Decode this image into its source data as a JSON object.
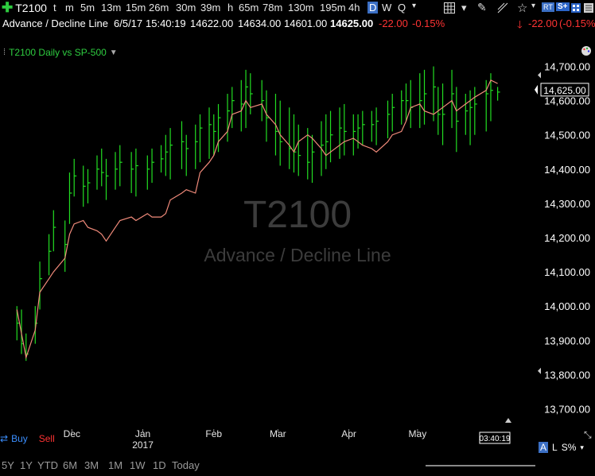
{
  "toolbar": {
    "symbol": "T2100",
    "timeframes": [
      "t",
      "m",
      "5m",
      "13m",
      "15m",
      "26m",
      "30m",
      "39m",
      "h",
      "65m",
      "78m",
      "130m",
      "195m",
      "4h",
      "D",
      "W",
      "Q"
    ],
    "active_timeframe": "D",
    "rt_badge": "RT",
    "s_badge": "S+"
  },
  "info": {
    "name": "Advance / Decline Line",
    "date": "6/5/17",
    "time": "15:40:19",
    "open": "14622.00",
    "high": "14634.00",
    "low": "14601.00",
    "close": "14625.00",
    "change": "-22.00",
    "change_pct": "-0.15%",
    "right_change": "-22.00",
    "right_change_pct": "(-0.15%)"
  },
  "study": {
    "label": "T2100 Daily vs SP-500"
  },
  "watermark": {
    "symbol": "T2100",
    "name": "Advance / Decline Line"
  },
  "price_axis": {
    "labels": [
      "14,700.00",
      "14,600.00",
      "14,500.00",
      "14,400.00",
      "14,300.00",
      "14,200.00",
      "14,100.00",
      "14,000.00",
      "13,900.00",
      "13,800.00",
      "13,700.00"
    ],
    "current_price_label": "14,625.00"
  },
  "x_axis": {
    "labels": [
      "Dec",
      "Jan",
      "Feb",
      "Mar",
      "Apr",
      "May"
    ],
    "year_label": "2017",
    "time_box": "03:40:19"
  },
  "trade": {
    "buy": "Buy",
    "sell": "Sell"
  },
  "bottom": {
    "ranges": [
      "5Y",
      "1Y",
      "YTD",
      "6M",
      "3M",
      "1M",
      "1W",
      "1D",
      "Today"
    ],
    "right_a": "A",
    "right_l": "L",
    "right_s": "S%"
  },
  "colors": {
    "bar": "#22dd22",
    "line": "#f08a7a",
    "up": "#22dd22",
    "down": "#ff3333",
    "accent": "#3b6fc4"
  },
  "chart_data": {
    "type": "line",
    "ylim": [
      13650,
      14750
    ],
    "series": [
      {
        "name": "T2100",
        "kind": "hlc-bars",
        "x": [
          "2016-11-07",
          "2016-11-09",
          "2016-11-11",
          "2016-11-15",
          "2016-11-17",
          "2016-11-21",
          "2016-11-23",
          "2016-11-28",
          "2016-11-30",
          "2016-12-02",
          "2016-12-06",
          "2016-12-08",
          "2016-12-12",
          "2016-12-14",
          "2016-12-16",
          "2016-12-20",
          "2016-12-22",
          "2016-12-27",
          "2016-12-29",
          "2017-01-03",
          "2017-01-05",
          "2017-01-09",
          "2017-01-11",
          "2017-01-13",
          "2017-01-18",
          "2017-01-20",
          "2017-01-24",
          "2017-01-26",
          "2017-01-30",
          "2017-02-01",
          "2017-02-03",
          "2017-02-07",
          "2017-02-09",
          "2017-02-13",
          "2017-02-15",
          "2017-02-17",
          "2017-02-22",
          "2017-02-24",
          "2017-02-28",
          "2017-03-02",
          "2017-03-06",
          "2017-03-08",
          "2017-03-10",
          "2017-03-14",
          "2017-03-16",
          "2017-03-20",
          "2017-03-22",
          "2017-03-24",
          "2017-03-28",
          "2017-03-30",
          "2017-04-03",
          "2017-04-05",
          "2017-04-07",
          "2017-04-11",
          "2017-04-13",
          "2017-04-18",
          "2017-04-20",
          "2017-04-24",
          "2017-04-26",
          "2017-04-28",
          "2017-05-02",
          "2017-05-04",
          "2017-05-08",
          "2017-05-10",
          "2017-05-12",
          "2017-05-16",
          "2017-05-18",
          "2017-05-22",
          "2017-05-24",
          "2017-05-26",
          "2017-05-31",
          "2017-06-02",
          "2017-06-05"
        ],
        "high": [
          14000,
          13990,
          13920,
          14000,
          14130,
          14210,
          14280,
          14250,
          14390,
          14430,
          14410,
          14400,
          14440,
          14460,
          14430,
          14450,
          14470,
          14450,
          14460,
          14440,
          14460,
          14470,
          14500,
          14520,
          14540,
          14500,
          14530,
          14560,
          14580,
          14560,
          14590,
          14620,
          14640,
          14660,
          14690,
          14680,
          14660,
          14630,
          14620,
          14600,
          14580,
          14560,
          14530,
          14520,
          14500,
          14540,
          14560,
          14570,
          14580,
          14590,
          14560,
          14560,
          14570,
          14570,
          14580,
          14600,
          14620,
          14630,
          14650,
          14660,
          14680,
          14690,
          14700,
          14640,
          14650,
          14690,
          14640,
          14620,
          14630,
          14640,
          14660,
          14680,
          14640
        ],
        "low": [
          13900,
          13860,
          13840,
          13890,
          13990,
          14090,
          14160,
          14100,
          14240,
          14320,
          14290,
          14300,
          14340,
          14350,
          14310,
          14340,
          14350,
          14330,
          14320,
          14340,
          14360,
          14390,
          14380,
          14370,
          14400,
          14380,
          14400,
          14420,
          14430,
          14440,
          14450,
          14480,
          14520,
          14510,
          14520,
          14560,
          14540,
          14480,
          14440,
          14410,
          14400,
          14390,
          14380,
          14370,
          14360,
          14380,
          14400,
          14420,
          14430,
          14440,
          14440,
          14460,
          14470,
          14480,
          14470,
          14490,
          14510,
          14530,
          14540,
          14520,
          14520,
          14530,
          14540,
          14500,
          14470,
          14520,
          14450,
          14500,
          14470,
          14500,
          14510,
          14540,
          14600
        ],
        "close": [
          13950,
          13890,
          13860,
          13950,
          14080,
          14160,
          14230,
          14180,
          14330,
          14380,
          14350,
          14360,
          14400,
          14390,
          14380,
          14400,
          14420,
          14400,
          14410,
          14400,
          14420,
          14430,
          14450,
          14470,
          14480,
          14460,
          14480,
          14520,
          14530,
          14510,
          14550,
          14570,
          14600,
          14590,
          14640,
          14620,
          14600,
          14550,
          14510,
          14480,
          14460,
          14450,
          14440,
          14420,
          14450,
          14470,
          14480,
          14500,
          14520,
          14510,
          14510,
          14520,
          14530,
          14530,
          14540,
          14560,
          14580,
          14600,
          14600,
          14580,
          14600,
          14620,
          14640,
          14560,
          14560,
          14620,
          14540,
          14570,
          14580,
          14590,
          14620,
          14630,
          14625
        ]
      },
      {
        "name": "SP-500",
        "kind": "line",
        "x": [
          "2016-11-07",
          "2016-11-09",
          "2016-11-11",
          "2016-11-15",
          "2016-11-17",
          "2016-11-21",
          "2016-11-23",
          "2016-11-28",
          "2016-11-30",
          "2016-12-02",
          "2016-12-06",
          "2016-12-08",
          "2016-12-12",
          "2016-12-14",
          "2016-12-16",
          "2016-12-20",
          "2016-12-22",
          "2016-12-27",
          "2016-12-29",
          "2017-01-03",
          "2017-01-05",
          "2017-01-09",
          "2017-01-11",
          "2017-01-13",
          "2017-01-18",
          "2017-01-20",
          "2017-01-24",
          "2017-01-26",
          "2017-01-30",
          "2017-02-01",
          "2017-02-03",
          "2017-02-07",
          "2017-02-09",
          "2017-02-13",
          "2017-02-15",
          "2017-02-17",
          "2017-02-22",
          "2017-02-24",
          "2017-02-28",
          "2017-03-02",
          "2017-03-06",
          "2017-03-08",
          "2017-03-10",
          "2017-03-14",
          "2017-03-16",
          "2017-03-20",
          "2017-03-22",
          "2017-03-24",
          "2017-03-28",
          "2017-03-30",
          "2017-04-03",
          "2017-04-05",
          "2017-04-07",
          "2017-04-11",
          "2017-04-13",
          "2017-04-18",
          "2017-04-20",
          "2017-04-24",
          "2017-04-26",
          "2017-04-28",
          "2017-05-02",
          "2017-05-04",
          "2017-05-08",
          "2017-05-10",
          "2017-05-12",
          "2017-05-16",
          "2017-05-18",
          "2017-05-22",
          "2017-05-24",
          "2017-05-26",
          "2017-05-31",
          "2017-06-02",
          "2017-06-05"
        ],
        "values": [
          13990,
          13920,
          13850,
          13930,
          14040,
          14080,
          14100,
          14140,
          14210,
          14240,
          14250,
          14230,
          14220,
          14210,
          14190,
          14230,
          14250,
          14260,
          14250,
          14270,
          14260,
          14260,
          14270,
          14310,
          14330,
          14340,
          14330,
          14390,
          14420,
          14440,
          14480,
          14510,
          14560,
          14570,
          14600,
          14580,
          14590,
          14560,
          14530,
          14500,
          14470,
          14450,
          14480,
          14500,
          14490,
          14460,
          14440,
          14450,
          14470,
          14480,
          14490,
          14480,
          14470,
          14460,
          14450,
          14480,
          14500,
          14510,
          14540,
          14580,
          14590,
          14570,
          14560,
          14570,
          14580,
          14600,
          14570,
          14590,
          14600,
          14610,
          14630,
          14660,
          14650
        ]
      }
    ]
  }
}
